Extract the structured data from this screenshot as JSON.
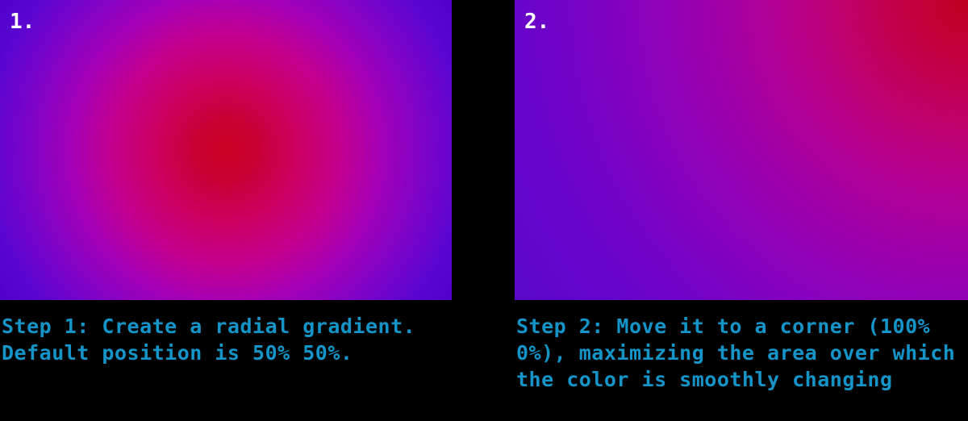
{
  "background_color": "#000000",
  "caption_color": "#1594c8",
  "label_color": "#ffffff",
  "panels": [
    {
      "number_label": "1.",
      "caption": "Step 1: Create a radial gradient. Default position is 50% 50%.",
      "gradient": {
        "type": "radial",
        "position": "50% 50%",
        "center_color": "#cc0022",
        "mid_color": "#cc005f",
        "edge_color": "#5000cc"
      }
    },
    {
      "number_label": "2.",
      "caption": "Step 2: Move it to a corner (100% 0%), maximizing the area over which the color is smoothly changing",
      "gradient": {
        "type": "radial",
        "position": "100% 0%",
        "center_color": "#c00020",
        "mid_color": "#a000a8",
        "edge_color": "#5a08c8"
      }
    }
  ]
}
